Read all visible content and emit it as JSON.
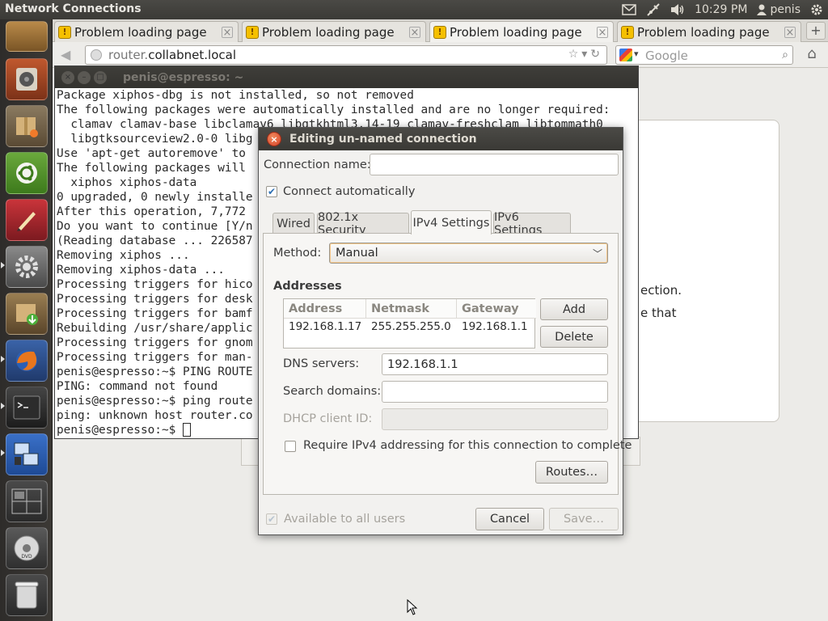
{
  "top_panel": {
    "app_title": "Network Connections",
    "clock": "10:29 PM",
    "user": "penis"
  },
  "launcher": {
    "items": [
      "files-app-icon",
      "rhythmbox-icon",
      "archive-manager-icon",
      "ubuntu-software-center-icon",
      "text-editor-icon",
      "system-settings-icon",
      "update-manager-icon",
      "firefox-icon",
      "terminal-icon",
      "workspace-switcher-icon",
      "workspaces-icon",
      "dvd-icon",
      "trash-icon"
    ]
  },
  "browser": {
    "tabs": [
      {
        "label": "Problem loading page"
      },
      {
        "label": "Problem loading page"
      },
      {
        "label": "Problem loading page"
      },
      {
        "label": "Problem loading page"
      }
    ],
    "url_prefix": "router.",
    "url_domain": "collabnet.local",
    "search_placeholder": "Google",
    "page_fragments": [
      "ection.",
      "e that"
    ]
  },
  "terminal": {
    "title": "penis@espresso: ~",
    "lines": [
      "Package xiphos-dbg is not installed, so not removed",
      "The following packages were automatically installed and are no longer required:",
      "  clamav clamav-base libclamav6 libgtkhtml3.14-19 clamav-freshclam libtommath0",
      "  libgtksourceview2.0-0 libg",
      "Use 'apt-get autoremove' to",
      "The following packages will",
      "  xiphos xiphos-data",
      "0 upgraded, 0 newly installe",
      "After this operation, 7,772",
      "Do you want to continue [Y/n",
      "(Reading database ... 226587",
      "Removing xiphos ...",
      "Removing xiphos-data ...",
      "Processing triggers for hico",
      "Processing triggers for desk",
      "Processing triggers for bamf",
      "Rebuilding /usr/share/applic",
      "Processing triggers for gnom",
      "Processing triggers for man-",
      "penis@espresso:~$ PING ROUTE",
      "PING: command not found",
      "penis@espresso:~$ ping route",
      "ping: unknown host router.co"
    ],
    "prompt": "penis@espresso:~$ "
  },
  "dialog": {
    "title": "Editing un-named connection",
    "connection_name_label": "Connection name:",
    "connection_name_value": "",
    "connect_automatically_label": "Connect automatically",
    "connect_automatically_checked": true,
    "tabs": [
      "Wired",
      "802.1x Security",
      "IPv4 Settings",
      "IPv6 Settings"
    ],
    "active_tab": "IPv4 Settings",
    "method_label": "Method:",
    "method_value": "Manual",
    "addresses_label": "Addresses",
    "addresses_columns": [
      "Address",
      "Netmask",
      "Gateway"
    ],
    "addresses_rows": [
      {
        "address": "192.168.1.17",
        "netmask": "255.255.255.0",
        "gateway": "192.168.1.1"
      }
    ],
    "add_label": "Add",
    "delete_label": "Delete",
    "dns_label": "DNS servers:",
    "dns_value": "192.168.1.1",
    "search_domains_label": "Search domains:",
    "search_domains_value": "",
    "dhcp_client_id_label": "DHCP client ID:",
    "dhcp_client_id_value": "",
    "require_ipv4_label": "Require IPv4 addressing for this connection to complete",
    "require_ipv4_checked": false,
    "routes_label": "Routes…",
    "available_to_all_label": "Available to all users",
    "available_to_all_checked": true,
    "cancel_label": "Cancel",
    "save_label": "Save…"
  }
}
